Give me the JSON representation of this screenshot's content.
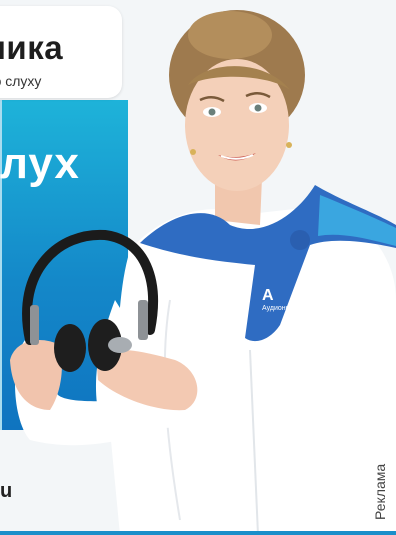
{
  "card": {
    "brand": "ника",
    "tagline": "по слуху"
  },
  "banner": {
    "headline": "лух"
  },
  "footer": {
    "url": "u"
  },
  "ad_label": "Реклама",
  "scarf_logo_text": "Аудионика",
  "colors": {
    "accent_blue": "#1488c9",
    "scarf_blue": "#2f6cc2",
    "panel_top": "#1eb3d9"
  }
}
